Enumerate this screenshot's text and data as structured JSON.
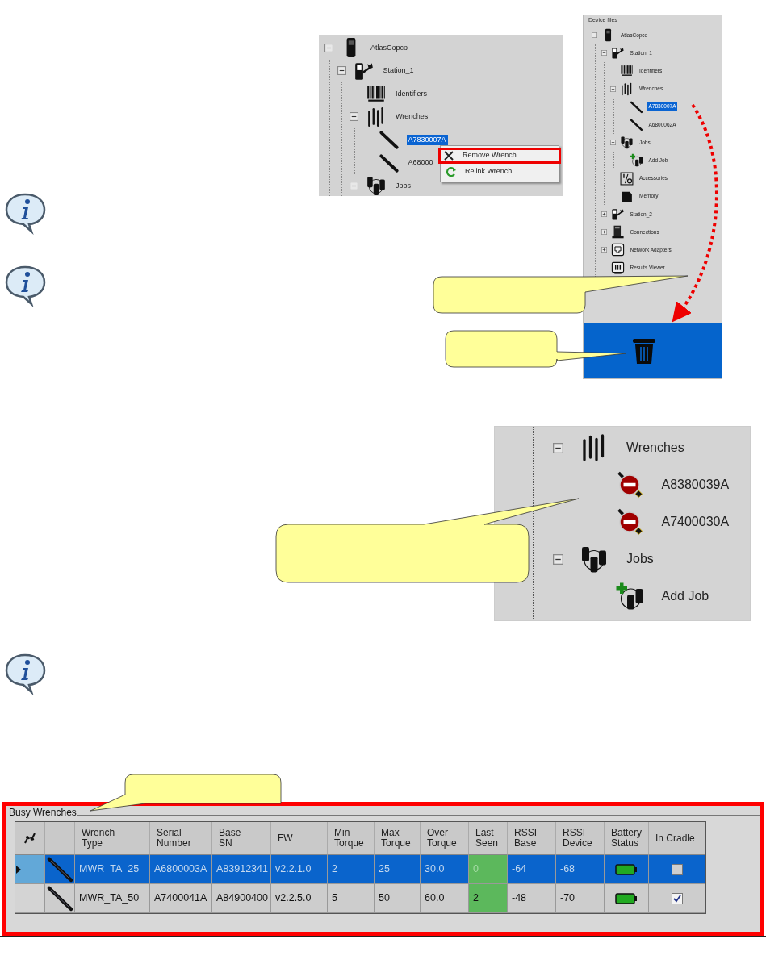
{
  "context_menu_figure": {
    "tree": [
      {
        "kind": "device",
        "label": "AtlasCopco",
        "selected": false,
        "expanded": true,
        "children": [
          {
            "kind": "station",
            "label": "Station_1",
            "selected": false,
            "expanded": true,
            "children": [
              {
                "kind": "barcode",
                "label": "Identifiers",
                "selected": false
              },
              {
                "kind": "wrenches",
                "label": "Wrenches",
                "selected": false,
                "expanded": true,
                "children": [
                  {
                    "kind": "wrench",
                    "label": "A7830007A",
                    "selected": true
                  },
                  {
                    "kind": "wrench",
                    "label": "A68000",
                    "selected": false
                  }
                ]
              },
              {
                "kind": "jobs",
                "label": "Jobs",
                "selected": false,
                "expanded": true
              }
            ]
          }
        ]
      }
    ],
    "context_menu": [
      {
        "kind": "remove",
        "label": "Remove Wrench",
        "outlined": true
      },
      {
        "kind": "relink",
        "label": "Relink Wrench",
        "outlined": false
      }
    ]
  },
  "device_files_panel": {
    "title": "Device files",
    "tree": [
      {
        "kind": "device",
        "label": "AtlasCopco",
        "selected": false,
        "expanded": true,
        "children": [
          {
            "kind": "station",
            "label": "Station_1",
            "selected": false,
            "expanded": true,
            "children": [
              {
                "kind": "barcode",
                "label": "Identifiers",
                "selected": false
              },
              {
                "kind": "wrenches",
                "label": "Wrenches",
                "selected": false,
                "expanded": true,
                "children": [
                  {
                    "kind": "wrench",
                    "label": "A7830007A",
                    "selected": true
                  },
                  {
                    "kind": "wrench",
                    "label": "A6800062A",
                    "selected": false
                  }
                ]
              },
              {
                "kind": "jobs",
                "label": "Jobs",
                "selected": false,
                "expanded": true,
                "children": [
                  {
                    "kind": "add-job",
                    "label": "Add Job",
                    "selected": false
                  }
                ]
              },
              {
                "kind": "accessories",
                "label": "Accessories",
                "selected": false
              },
              {
                "kind": "memory",
                "label": "Memory",
                "selected": false
              }
            ]
          },
          {
            "kind": "station",
            "label": "Station_2",
            "selected": false,
            "expanded": false
          },
          {
            "kind": "connections",
            "label": "Connections",
            "selected": false,
            "expanded": false
          },
          {
            "kind": "network",
            "label": "Network Adapters",
            "selected": false,
            "expanded": false
          },
          {
            "kind": "results",
            "label": "Results Viewer",
            "selected": false
          }
        ]
      }
    ]
  },
  "wrench_tree_figure": {
    "tree": [
      {
        "kind": "wrenches",
        "label": "Wrenches",
        "selected": false,
        "expanded": true,
        "children": [
          {
            "kind": "wrench-blocked",
            "label": "A8380039A",
            "selected": false
          },
          {
            "kind": "wrench-blocked",
            "label": "A7400030A",
            "selected": false
          }
        ]
      },
      {
        "kind": "jobs",
        "label": "Jobs",
        "selected": false,
        "expanded": true,
        "children": [
          {
            "kind": "add-job",
            "label": "Add Job",
            "selected": false
          }
        ]
      }
    ]
  },
  "busy_wrenches": {
    "title": "Busy Wrenches",
    "columns": [
      {
        "kind": "text",
        "label": "Wrench\nType"
      },
      {
        "kind": "text",
        "label": "Serial\nNumber"
      },
      {
        "kind": "text",
        "label": "Base\nSN"
      },
      {
        "kind": "text",
        "label": "FW"
      },
      {
        "kind": "text",
        "label": "Min\nTorque"
      },
      {
        "kind": "text",
        "label": "Max\nTorque"
      },
      {
        "kind": "text",
        "label": "Over\nTorque"
      },
      {
        "kind": "highlight",
        "label": "Last\nSeen"
      },
      {
        "kind": "text",
        "label": "RSSI\nBase"
      },
      {
        "kind": "text",
        "label": "RSSI\nDevice"
      },
      {
        "kind": "battery",
        "label": "Battery\nStatus"
      },
      {
        "kind": "check",
        "label": "In Cradle"
      }
    ],
    "rows": [
      {
        "selected": true,
        "cells": [
          "MWR_TA_25",
          "A6800003A",
          "A83912341",
          "v2.2.1.0",
          "2",
          "25",
          "30.0",
          "0",
          "-64",
          "-68"
        ],
        "in_cradle": false
      },
      {
        "selected": false,
        "cells": [
          "MWR_TA_50",
          "A7400041A",
          "A84900400",
          "v2.2.5.0",
          "5",
          "50",
          "60.0",
          "2",
          "-48",
          "-70"
        ],
        "in_cradle": true
      }
    ]
  }
}
